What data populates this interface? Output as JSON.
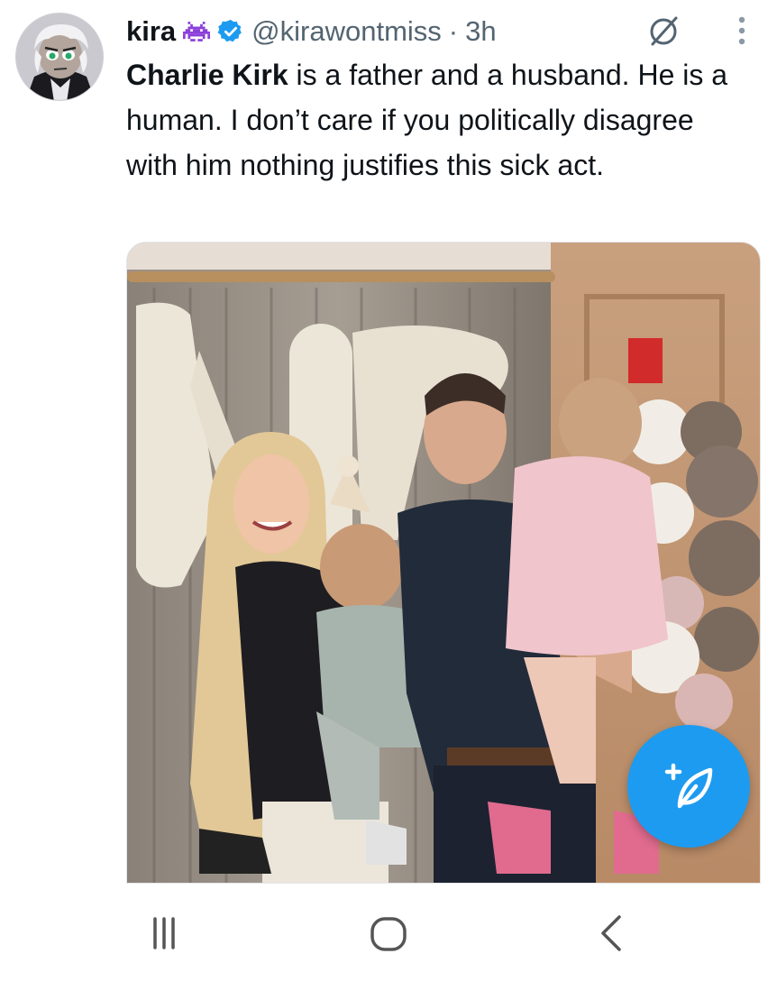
{
  "tweet": {
    "display_name": "kira",
    "name_emoji": "space-invader-emoji",
    "verified": true,
    "handle": "@kirawontmiss",
    "separator": "·",
    "time": "3h",
    "text_bold": "Charlie Kirk",
    "text_rest": " is a father and a husband. He is a human. I don’t care if you politically disagree with him nothing justifies this sick act."
  },
  "colors": {
    "accent": "#1d9bf0",
    "secondary_text": "#536471",
    "primary_text": "#0f1419",
    "emoji_purple": "#8b3fd9"
  },
  "icons": {
    "grok": "grok-icon",
    "more": "more-vertical-icon",
    "fab": "compose-post-icon",
    "nav_recents": "recent-apps-icon",
    "nav_home": "home-icon",
    "nav_back": "back-icon"
  }
}
